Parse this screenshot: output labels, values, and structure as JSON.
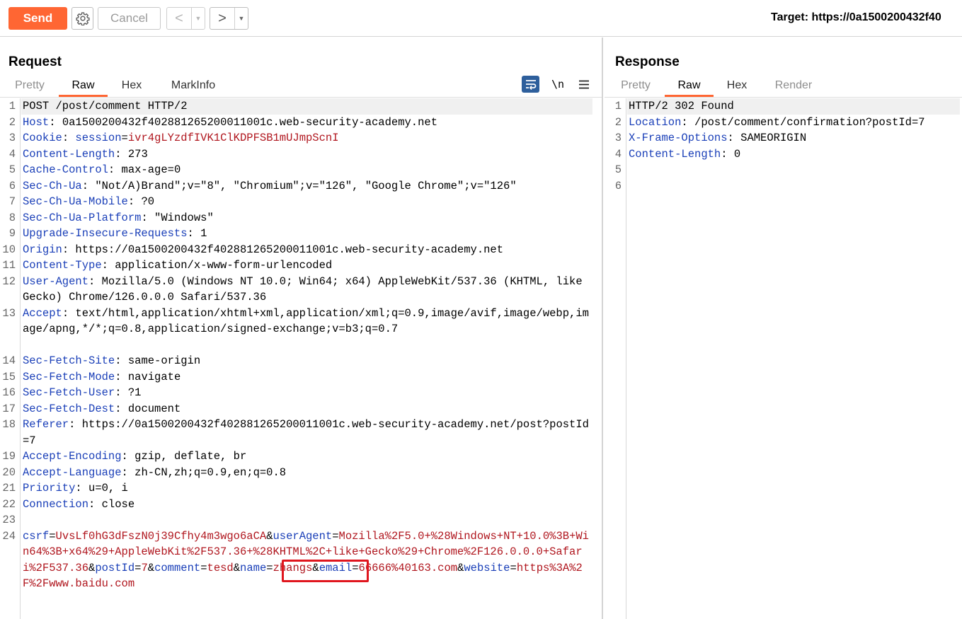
{
  "toolbar": {
    "send_label": "Send",
    "settings_icon": "gear-icon",
    "cancel_label": "Cancel",
    "back_label": "<",
    "forward_label": ">",
    "dropdown_glyph": "▼",
    "target_text": "Target: https://0a1500200432f40"
  },
  "request": {
    "title": "Request",
    "tabs": [
      "Pretty",
      "Raw",
      "Hex",
      "MarkInfo"
    ],
    "active_tab": "Raw",
    "icons": {
      "wrap": "word-wrap-icon",
      "newline_label": "\\n",
      "menu": "hamburger-menu-icon"
    },
    "lines": [
      {
        "n": "1",
        "name": "",
        "value": "POST /post/comment HTTP/2"
      },
      {
        "n": "2",
        "name": "Host",
        "value": "0a1500200432f402881265200011001c.web-security-academy.net"
      },
      {
        "n": "3",
        "name": "Cookie",
        "cookie_name": "session",
        "cookie_value": "ivr4gLYzdfIVK1ClKDPFSB1mUJmpScnI"
      },
      {
        "n": "4",
        "name": "Content-Length",
        "value": "273"
      },
      {
        "n": "5",
        "name": "Cache-Control",
        "value": "max-age=0"
      },
      {
        "n": "6",
        "name": "Sec-Ch-Ua",
        "value": "\"Not/A)Brand\";v=\"8\", \"Chromium\";v=\"126\", \"Google Chrome\";v=\"126\""
      },
      {
        "n": "7",
        "name": "Sec-Ch-Ua-Mobile",
        "value": "?0"
      },
      {
        "n": "8",
        "name": "Sec-Ch-Ua-Platform",
        "value": "\"Windows\""
      },
      {
        "n": "9",
        "name": "Upgrade-Insecure-Requests",
        "value": "1"
      },
      {
        "n": "10",
        "name": "Origin",
        "value": "https://0a1500200432f402881265200011001c.web-security-academy.net"
      },
      {
        "n": "11",
        "name": "Content-Type",
        "value": "application/x-www-form-urlencoded"
      },
      {
        "n": "12",
        "name": "User-Agent",
        "value": "Mozilla/5.0 (Windows NT 10.0; Win64; x64) AppleWebKit/537.36 (KHTML, like Gecko) Chrome/126.0.0.0 Safari/537.36"
      },
      {
        "n": "13",
        "name": "Accept",
        "value": "text/html,application/xhtml+xml,application/xml;q=0.9,image/avif,image/webp,image/apng,*/*;q=0.8,application/signed-exchange;v=b3;q=0.7"
      },
      {
        "n": "14",
        "name": "Sec-Fetch-Site",
        "value": "same-origin"
      },
      {
        "n": "15",
        "name": "Sec-Fetch-Mode",
        "value": "navigate"
      },
      {
        "n": "16",
        "name": "Sec-Fetch-User",
        "value": "?1"
      },
      {
        "n": "17",
        "name": "Sec-Fetch-Dest",
        "value": "document"
      },
      {
        "n": "18",
        "name": "Referer",
        "value": "https://0a1500200432f402881265200011001c.web-security-academy.net/post?postId=7"
      },
      {
        "n": "19",
        "name": "Accept-Encoding",
        "value": "gzip, deflate, br"
      },
      {
        "n": "20",
        "name": "Accept-Language",
        "value": "zh-CN,zh;q=0.9,en;q=0.8"
      },
      {
        "n": "21",
        "name": "Priority",
        "value": "u=0, i"
      },
      {
        "n": "22",
        "name": "Connection",
        "value": "close"
      },
      {
        "n": "23"
      },
      {
        "n": "24"
      }
    ],
    "body_params": [
      {
        "key": "csrf",
        "value": "UvsLf0hG3dFszN0j39Cfhy4m3wgo6aCA"
      },
      {
        "key": "userAgent",
        "value": "Mozilla%2F5.0+%28Windows+NT+10.0%3B+Win64%3B+x64%29+AppleWebKit%2F537.36+%28KHTML%2C+like+Gecko%29+Chrome%2F126.0.0.0+Safari%2F537.36"
      },
      {
        "key": "postId",
        "value": "7"
      },
      {
        "key": "comment",
        "value": "tesd"
      },
      {
        "key": "name",
        "value": "zhangs"
      },
      {
        "key": "email",
        "value": "66666%40163.com"
      },
      {
        "key": "website",
        "value": "https%3A%2F%2Fwww.baidu.com"
      }
    ],
    "highlight_color": "#e0161e"
  },
  "response": {
    "title": "Response",
    "tabs": [
      "Pretty",
      "Raw",
      "Hex",
      "Render"
    ],
    "active_tab": "Raw",
    "lines": [
      {
        "n": "1",
        "name": "",
        "value": "HTTP/2 302 Found"
      },
      {
        "n": "2",
        "name": "Location",
        "value": "/post/comment/confirmation?postId=7"
      },
      {
        "n": "3",
        "name": "X-Frame-Options",
        "value": "SAMEORIGIN"
      },
      {
        "n": "4",
        "name": "Content-Length",
        "value": "0"
      },
      {
        "n": "5"
      },
      {
        "n": "6"
      }
    ]
  },
  "colors": {
    "accent": "#ff6633",
    "header_name": "#1a3fb8",
    "param_value": "#b0161e"
  }
}
